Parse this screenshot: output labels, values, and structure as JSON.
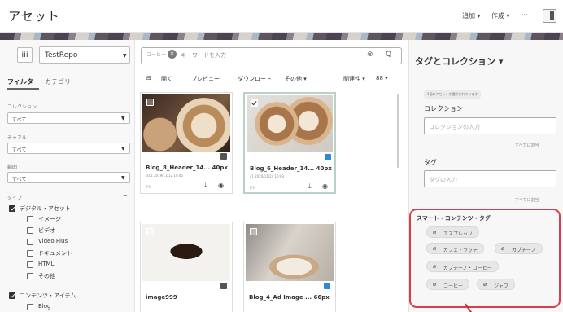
{
  "header": {
    "title": "アセット",
    "add_label": "追加 ▾",
    "create_label": "作成 ▾",
    "more_label": "···"
  },
  "left": {
    "repo": {
      "icon": "iii",
      "value": "TestRepo"
    },
    "tabs": [
      "フィルタ",
      "カテゴリ"
    ],
    "collection": {
      "label": "コレクション",
      "value": "すべて"
    },
    "channel": {
      "label": "チャネル",
      "value": "すべて"
    },
    "area": {
      "label": "範囲",
      "value": "すべて"
    },
    "type": {
      "label": "タイプ",
      "collapse": "−"
    },
    "digital": "デジタル・アセット",
    "digital_items": [
      "イメージ",
      "ビデオ",
      "Video Plus",
      "ドキュメント",
      "HTML",
      "その他"
    ],
    "content": "コンテンツ・アイテム",
    "content_items": [
      "Blog"
    ]
  },
  "search": {
    "chip": "コーヒー",
    "chip_clear": "×",
    "placeholder": "キーワードを入力",
    "clear": "⊗",
    "icon": "Q"
  },
  "toolbar": {
    "select": "⊟",
    "open": "開く",
    "preview": "プレビュー",
    "download": "ダウンロード",
    "other": "その他 ▾",
    "relevance": "関連性 ▾",
    "grid": "88 ▾"
  },
  "cards": [
    {
      "title": "Blog_8_Header_14... 40px",
      "meta": "v0.1  2019/11/12 10:06",
      "type": "JPG",
      "dl": "⤓",
      "view": "◉"
    },
    {
      "title": "Blog_6_Header_14... 40px",
      "meta": "v1  2020/11/24 10:03",
      "type": "JPG",
      "dl": "⤓",
      "view": "◉"
    },
    {
      "title": "image999"
    },
    {
      "title": "Blog_4_Ad Image ... 66px"
    }
  ],
  "right": {
    "title": "タグとコレクション ▾",
    "note": "1個のアセットが選択されています",
    "collection_label": "コレクション",
    "collection_placeholder": "コレクションの入力",
    "remove_all": "すべてに割当",
    "tag_label": "タグ",
    "tag_placeholder": "タグの入力",
    "remove_all2": "すべてに割当",
    "smart_title": "スマート・コンテンツ・タグ",
    "smart_tags": [
      "エスプレッソ",
      "カフェ・ラッテ",
      "カプチーノ",
      "カプチーノ・コーヒー",
      "コーヒー",
      "ジャワ"
    ]
  },
  "colors": {
    "highlight": "#d6404a",
    "selected_card": "#b6d3c5",
    "badge_blue": "#2d8ad6"
  }
}
